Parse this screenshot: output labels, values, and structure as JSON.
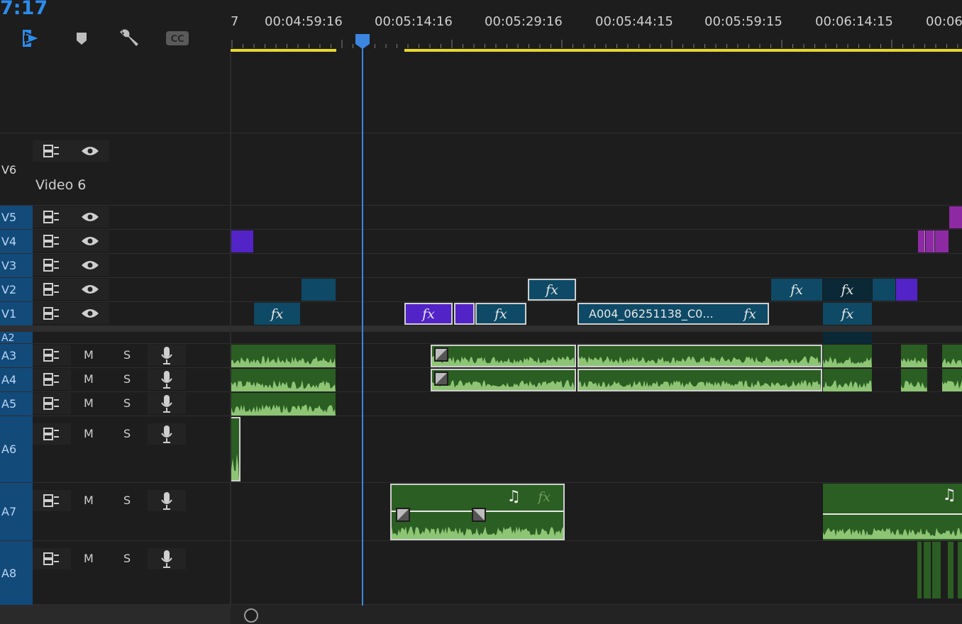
{
  "timecode": "7:17",
  "toolbar": {
    "icons": [
      "snap-icon",
      "marker-icon",
      "wrench-icon",
      "captions-icon"
    ],
    "captions_label": "CC"
  },
  "ruler": {
    "labels": [
      "7",
      "00:04:59:16",
      "00:05:14:16",
      "00:05:29:16",
      "00:05:44:15",
      "00:05:59:15",
      "00:06:14:15",
      "00:06"
    ]
  },
  "tracks": {
    "video": [
      {
        "id": "V6",
        "name": "Video 6",
        "selected": false
      },
      {
        "id": "V5",
        "selected": true
      },
      {
        "id": "V4",
        "selected": true
      },
      {
        "id": "V3",
        "selected": true
      },
      {
        "id": "V2",
        "selected": true
      },
      {
        "id": "V1",
        "selected": true
      }
    ],
    "audio": [
      {
        "id": "A2",
        "selected": true
      },
      {
        "id": "A3",
        "selected": true
      },
      {
        "id": "A4",
        "selected": true
      },
      {
        "id": "A5",
        "selected": true
      },
      {
        "id": "A6",
        "selected": true
      },
      {
        "id": "A7",
        "selected": true
      },
      {
        "id": "A8",
        "selected": true
      }
    ],
    "mute_label": "M",
    "solo_label": "S"
  },
  "clips": {
    "fx_label": "fx",
    "v1_named_clip": "A004_06251138_C0...",
    "music_icon": "♫"
  },
  "colors": {
    "accent": "#2d8ceb",
    "work_area": "#e9d82c",
    "video_clip": "#0e4a66",
    "adjustment_clip": "#5223c7",
    "audio_clip": "#2b5e22",
    "waveform": "#9fd784"
  }
}
